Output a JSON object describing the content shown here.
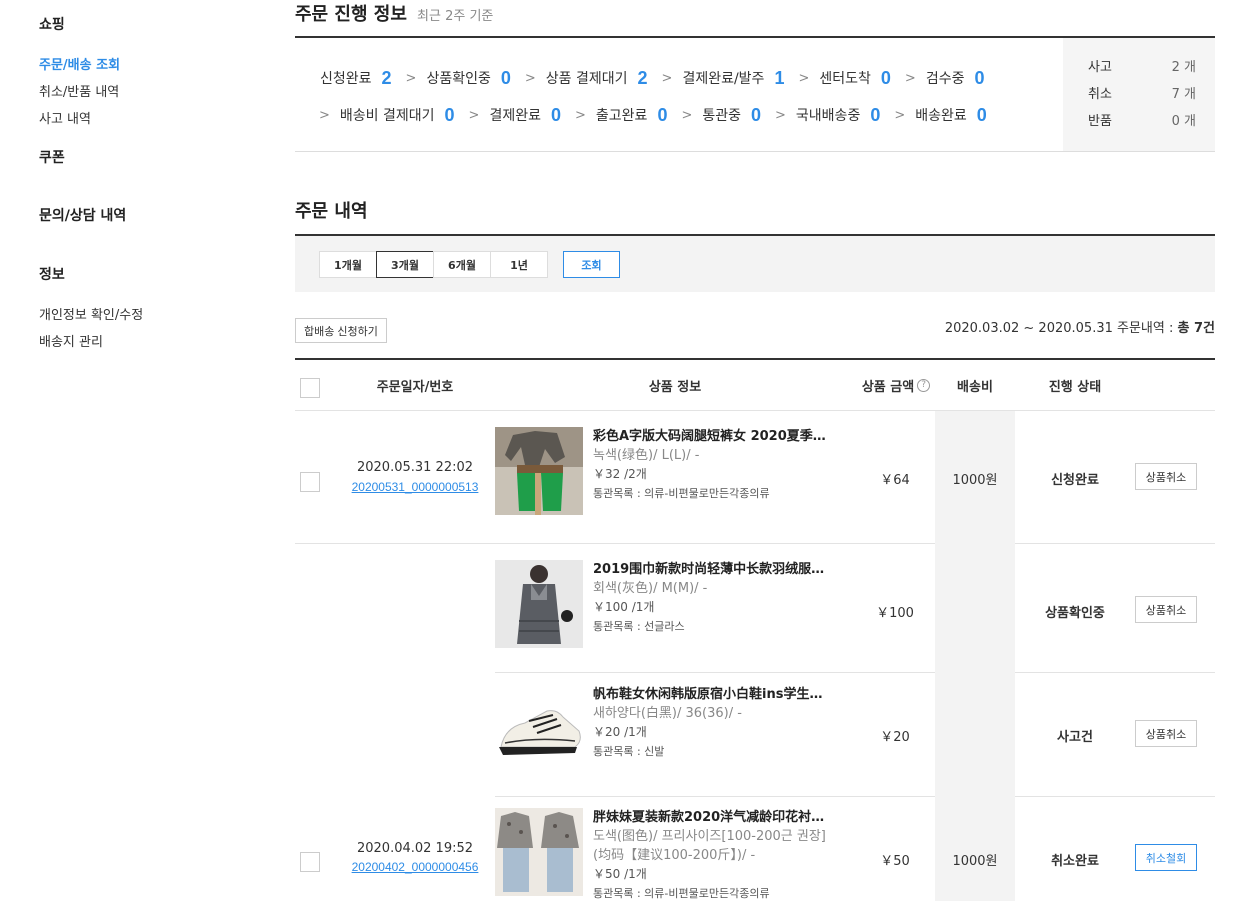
{
  "sidebar": {
    "shopping_heading": "쇼핑",
    "shopping_items": [
      "주문/배송 조회",
      "취소/반품 내역",
      "사고 내역"
    ],
    "coupon_heading": "쿠폰",
    "inquiry_heading": "문의/상담 내역",
    "info_heading": "정보",
    "info_items": [
      "개인정보 확인/수정",
      "배송지 관리"
    ]
  },
  "progress": {
    "title": "주문 진행 정보",
    "subtitle": "최근 2주 기준",
    "steps_line1": [
      {
        "label": "신청완료",
        "count": "2"
      },
      {
        "label": "상품확인중",
        "count": "0"
      },
      {
        "label": "상품 결제대기",
        "count": "2"
      },
      {
        "label": "결제완료/발주",
        "count": "1"
      },
      {
        "label": "센터도착",
        "count": "0"
      },
      {
        "label": "검수중",
        "count": "0"
      }
    ],
    "steps_line2": [
      {
        "label": "배송비 결제대기",
        "count": "0"
      },
      {
        "label": "결제완료",
        "count": "0"
      },
      {
        "label": "출고완료",
        "count": "0"
      },
      {
        "label": "통관중",
        "count": "0"
      },
      {
        "label": "국내배송중",
        "count": "0"
      },
      {
        "label": "배송완료",
        "count": "0"
      }
    ],
    "arrow": ">",
    "side_stats": [
      {
        "label": "사고",
        "value": "2 개"
      },
      {
        "label": "취소",
        "value": "7 개"
      },
      {
        "label": "반품",
        "value": "0 개"
      }
    ]
  },
  "orders": {
    "title": "주문 내역",
    "period_buttons": [
      "1개월",
      "3개월",
      "6개월",
      "1년"
    ],
    "search_label": "조회",
    "merge_button": "합배송 신청하기",
    "range_text": "2020.03.02 ~ 2020.05.31 주문내역 :",
    "range_total": "총 7건",
    "columns": {
      "date": "주문일자/번호",
      "product": "상품 정보",
      "amount": "상품 금액",
      "amount_help": "?",
      "shipping": "배송비",
      "status": "진행 상태"
    },
    "groups": [
      {
        "date": "2020.05.31 22:02",
        "order_no": "20200531_0000000513",
        "shipping": "1000원"
      },
      {
        "date": "",
        "order_no": "",
        "shipping": ""
      },
      {
        "date": "2020.04.02 19:52",
        "order_no": "20200402_0000000456",
        "shipping": "1000원"
      }
    ],
    "rows": [
      {
        "name": "彩色A字版大码阔腿短裤女 2020夏季…",
        "option": "녹색(绿色)/ L(L)/ -",
        "price": "￥32 /2개",
        "category": "통관목록 : 의류-비편물로만든각종의류",
        "amount": "￥64",
        "status": "신청완료",
        "action": "상품취소"
      },
      {
        "name": "2019围巾新款时尚轻薄中长款羽绒服…",
        "option": "회색(灰色)/ M(M)/ -",
        "price": "￥100 /1개",
        "category": "통관목록 : 선글라스",
        "amount": "￥100",
        "status": "상품확인중",
        "action": "상품취소"
      },
      {
        "name": "帆布鞋女休闲韩版原宿小白鞋ins学生…",
        "option": "새하양다(白黑)/ 36(36)/ -",
        "price": "￥20 /1개",
        "category": "통관목록 : 신발",
        "amount": "￥20",
        "status": "사고건",
        "action": "상품취소"
      },
      {
        "name": "胖妹妹夏装新款2020洋气减龄印花衬…",
        "option": "도색(图色)/ 프리사이즈[100-200근 권장]",
        "option2": "(均码【建议100-200斤】)/ -",
        "price": "￥50 /1개",
        "category": "통관목록 : 의류-비편물로만든각종의류",
        "amount": "￥50",
        "status": "취소완료",
        "action": "취소철회"
      }
    ]
  },
  "colors": {
    "accent": "#2e8ce6",
    "border_dark": "#333333",
    "panel_bg": "#f3f3f3"
  }
}
